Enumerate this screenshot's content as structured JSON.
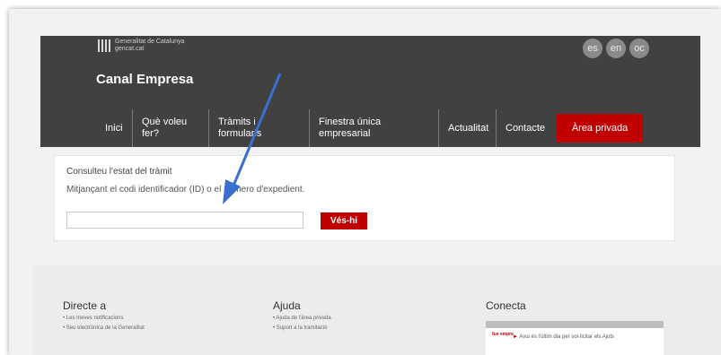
{
  "header": {
    "logo_text_line1": "Generalitat de Catalunya",
    "logo_text_line2": "gencat.cat",
    "site_title": "Canal Empresa",
    "languages": [
      "es",
      "en",
      "oc"
    ],
    "nav": {
      "inici": "Inici",
      "que_voleu_fer_1": "Què voleu",
      "que_voleu_fer_2": "fer?",
      "tramits_1": "Tràmits i",
      "tramits_2": "formularis",
      "finestra_1": "Finestra única",
      "finestra_2": "empresarial",
      "actualitat": "Actualitat",
      "contacte": "Contacte",
      "area_privada": "Àrea privada"
    }
  },
  "status_check": {
    "title": "Consulteu l'estat del tràmit",
    "subtitle": "Mitjançant el codi identificador (ID) o el número d'expedient.",
    "input_value": "",
    "button_label": "Vés-hi"
  },
  "footer": {
    "directe_title": "Directe a",
    "directe_links": [
      "• Les meves notificacions",
      "• Seu electrònica de la Generalitat"
    ],
    "ajuda_title": "Ajuda",
    "ajuda_links": [
      "• Ajuda de l'àrea privada",
      "• Suport a la tramitació"
    ],
    "conecta_title": "Conecta",
    "conecta_logo": "fue empre",
    "conecta_text": "Avui és l'últim dia per sol·licitar els Ajuts"
  },
  "colors": {
    "header_bg": "#414141",
    "accent_red": "#c00000",
    "arrow_blue": "#3a6fd0"
  }
}
